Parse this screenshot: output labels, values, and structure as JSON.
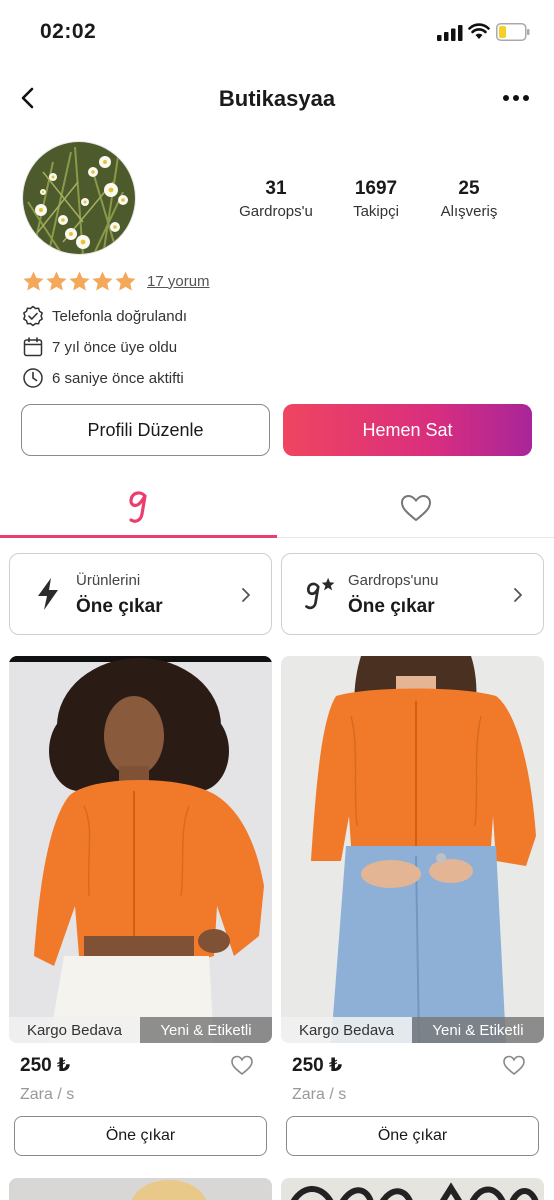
{
  "status_bar": {
    "time": "02:02"
  },
  "nav": {
    "title": "Butikasyaa"
  },
  "profile": {
    "stats": [
      {
        "value": "31",
        "label": "Gardrops'u"
      },
      {
        "value": "1697",
        "label": "Takipçi"
      },
      {
        "value": "25",
        "label": "Alışveriş"
      }
    ],
    "rating": {
      "stars": 5,
      "max_stars": 5,
      "reviews_link": "17 yorum"
    },
    "info": [
      {
        "icon": "verified-badge-icon",
        "text": "Telefonla doğrulandı"
      },
      {
        "icon": "calendar-icon",
        "text": "7 yıl önce üye oldu"
      },
      {
        "icon": "clock-icon",
        "text": "6 saniye önce aktifti"
      }
    ],
    "edit_button": "Profili Düzenle",
    "sell_button": "Hemen Sat"
  },
  "tabs": [
    {
      "icon": "gardrops-g-icon",
      "active": true
    },
    {
      "icon": "heart-icon",
      "active": false
    }
  ],
  "promos": [
    {
      "icon": "lightning-icon",
      "small": "Ürünlerini",
      "big": "Öne çıkar"
    },
    {
      "icon": "gardrops-star-icon",
      "small": "Gardrops'unu",
      "big": "Öne çıkar"
    }
  ],
  "products": [
    {
      "badge_left": "Kargo Bedava",
      "badge_right": "Yeni & Etiketli",
      "price": "250 ₺",
      "brand": "Zara / s",
      "button": "Öne çıkar"
    },
    {
      "badge_left": "Kargo Bedava",
      "badge_right": "Yeni & Etiketli",
      "price": "250 ₺",
      "brand": "Zara / s",
      "button": "Öne çıkar"
    }
  ],
  "colors": {
    "accent": "#ea3f6c",
    "star": "#f3a85a",
    "sell_gradient_start": "#ef4560",
    "sell_gradient_end": "#a8259a"
  }
}
